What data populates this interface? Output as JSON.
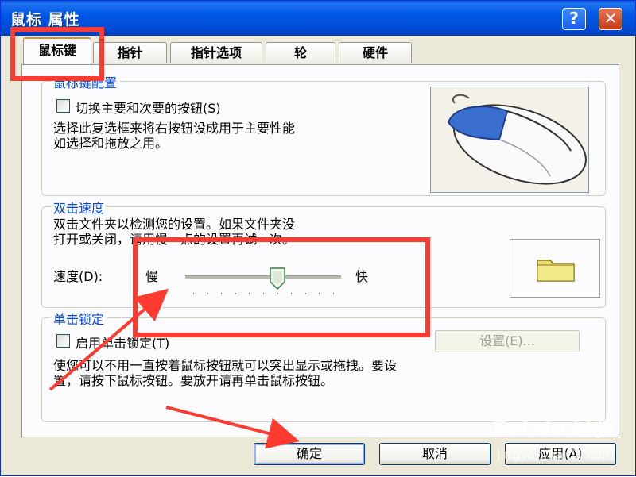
{
  "window": {
    "title": "鼠标 属性",
    "help_label": "?",
    "close_label": "✕"
  },
  "tabs": [
    {
      "label": "鼠标键",
      "active": true
    },
    {
      "label": "指针",
      "active": false
    },
    {
      "label": "指针选项",
      "active": false
    },
    {
      "label": "轮",
      "active": false
    },
    {
      "label": "硬件",
      "active": false
    }
  ],
  "button_config": {
    "legend": "鼠标键配置",
    "checkbox_label": "切换主要和次要的按钮(S)",
    "checked": false,
    "description_line1": "选择此复选框来将右按钮设成用于主要性能",
    "description_line2": "如选择和拖放之用。"
  },
  "double_click": {
    "legend": "双击速度",
    "description_line1": "双击文件夹以检测您的设置。如果文件夹没",
    "description_line2": "打开或关闭，请用慢一点的设置再试一次。",
    "speed_label": "速度(D):",
    "slow_label": "慢",
    "fast_label": "快",
    "speed_value": 0.6
  },
  "click_lock": {
    "legend": "单击锁定",
    "checkbox_label": "启用单击锁定(T)",
    "checked": false,
    "settings_button": "设置(E)...",
    "description_line1": "使您可以不用一直按着鼠标按钮就可以突出显示或拖拽。要设",
    "description_line2": "置，请按下鼠标按钮。要放开请再单击鼠标按钮。"
  },
  "footer": {
    "ok": "确定",
    "cancel": "取消",
    "apply": "应用(A)"
  },
  "watermark": {
    "text": "Bai du 经验",
    "url": "jingyan.baidu.com"
  },
  "colors": {
    "annotation": "#ff3b30",
    "titlebar": "#0058e6",
    "legend": "#0046d5"
  }
}
